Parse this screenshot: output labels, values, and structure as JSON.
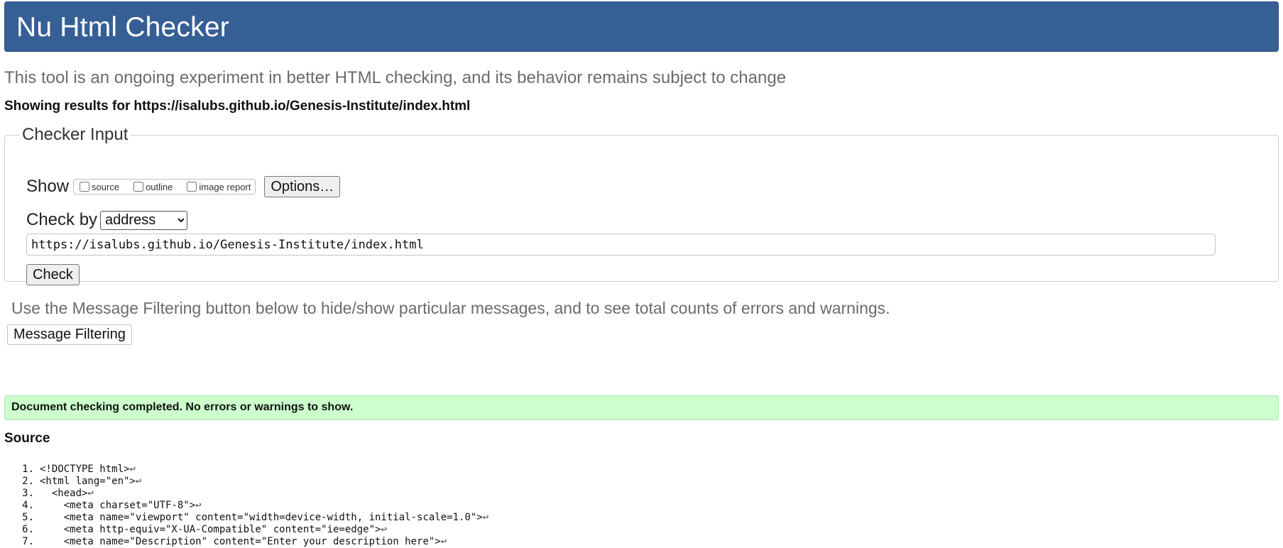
{
  "header": {
    "title": "Nu Html Checker"
  },
  "intro": "This tool is an ongoing experiment in better HTML checking, and its behavior remains subject to change",
  "results": {
    "label": "Showing results for",
    "url": "https://isalubs.github.io/Genesis-Institute/index.html"
  },
  "checker_input": {
    "legend": "Checker Input",
    "show_label": "Show",
    "show_options": [
      {
        "label": "source",
        "checked": false
      },
      {
        "label": "outline",
        "checked": false
      },
      {
        "label": "image report",
        "checked": false
      }
    ],
    "options_button": "Options…",
    "check_by_label": "Check by",
    "check_by_value": "address",
    "url_value": "https://isalubs.github.io/Genesis-Institute/index.html",
    "check_button": "Check"
  },
  "filter": {
    "info": "Use the Message Filtering button below to hide/show particular messages, and to see total counts of errors and warnings.",
    "button": "Message Filtering"
  },
  "status": {
    "message": "Document checking completed. No errors or warnings to show."
  },
  "source": {
    "heading": "Source",
    "line_end_symbol": "↩",
    "lines": [
      {
        "num": "1.",
        "text": "<!DOCTYPE html>"
      },
      {
        "num": "2.",
        "text": "<html lang=\"en\">"
      },
      {
        "num": "3.",
        "text": "  <head>"
      },
      {
        "num": "4.",
        "text": "    <meta charset=\"UTF-8\">"
      },
      {
        "num": "5.",
        "text": "    <meta name=\"viewport\" content=\"width=device-width, initial-scale=1.0\">"
      },
      {
        "num": "6.",
        "text": "    <meta http-equiv=\"X-UA-Compatible\" content=\"ie=edge\">"
      },
      {
        "num": "7.",
        "text": "    <meta name=\"Description\" content=\"Enter your description here\">"
      }
    ]
  }
}
